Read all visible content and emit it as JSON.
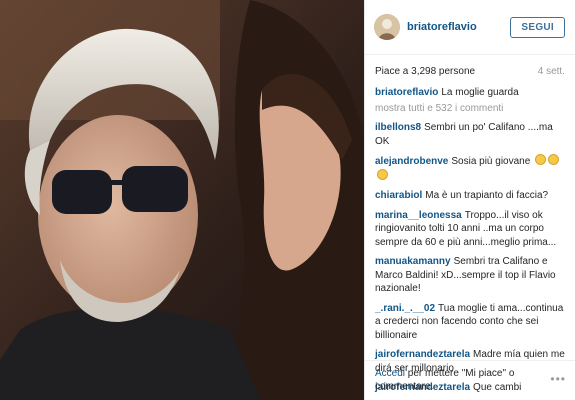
{
  "header": {
    "username": "briatoreflavio",
    "follow_label": "SEGUI"
  },
  "post": {
    "likes": "Piace a 3,298 persone",
    "time": "4 sett.",
    "caption_user": "briatoreflavio",
    "caption_text": "La moglie guarda",
    "view_all": "mostra tutti e 532 i commenti"
  },
  "comments": [
    {
      "user": "ilbellons8",
      "text": "Sembri un po' Califano ....ma OK",
      "emoji": 0
    },
    {
      "user": "alejandrobenve",
      "text": "Sosia più giovane",
      "emoji": 3
    },
    {
      "user": "chiarabiol",
      "text": "Ma è un trapianto di faccia?",
      "emoji": 0
    },
    {
      "user": "marina__leonessa",
      "text": "Troppo...il viso ok ringiovanito tolti 10 anni ..ma un corpo sempre da 60 e più anni...meglio prima...",
      "emoji": 0
    },
    {
      "user": "manuakamanny",
      "text": "Sembri tra Califano e Marco Baldini! xD...sempre il top il Flavio nazionale!",
      "emoji": 0
    },
    {
      "user": "_.rani._.__02",
      "text": "Tua moglie ti ama...continua a crederci non facendo conto che sei billionaire",
      "emoji": 0
    },
    {
      "user": "jairofernandeztarela",
      "text": "Madre mía quien me dirá ser millonario",
      "emoji": 0
    },
    {
      "user": "jairofernandeztarela",
      "text": "Que cambi",
      "emoji": 0
    }
  ],
  "footer": {
    "login_link": "Accedi",
    "login_rest": " per mettere \"Mi piace\" o commentare.",
    "more_icon": "more-options-icon"
  }
}
